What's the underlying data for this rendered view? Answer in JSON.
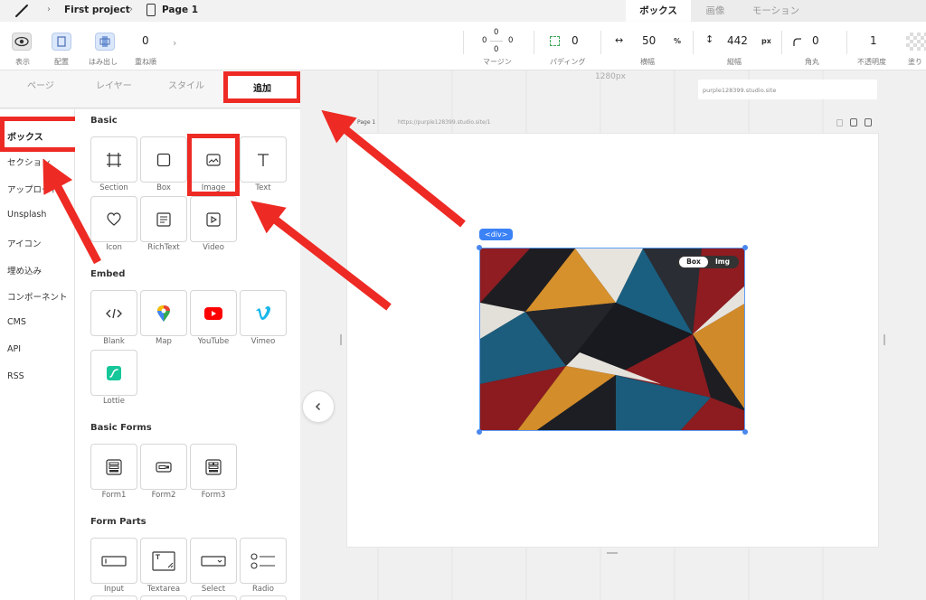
{
  "breadcrumb": {
    "project": "First project",
    "page": "Page 1"
  },
  "right_tabs": [
    {
      "label": "ボックス",
      "active": true
    },
    {
      "label": "画像",
      "active": false
    },
    {
      "label": "モーション",
      "active": false
    }
  ],
  "toolbar": {
    "show_label": "表示",
    "align_label": "配置",
    "overflow_label": "はみ出し",
    "zindex_value": "0",
    "zindex_label": "重ね順",
    "margin": {
      "top": "0",
      "left": "0",
      "right": "0",
      "bottom": "0",
      "label": "マージン"
    },
    "padding": {
      "value": "0",
      "label": "パディング"
    },
    "width": {
      "value": "50",
      "unit": "%",
      "label": "横幅"
    },
    "height": {
      "value": "442",
      "unit": "px",
      "label": "縦幅"
    },
    "radius": {
      "value": "0",
      "label": "角丸"
    },
    "opacity": {
      "value": "1",
      "label": "不透明度"
    },
    "fill_label": "塗り"
  },
  "left_tabs": [
    {
      "label": "ページ"
    },
    {
      "label": "レイヤー"
    },
    {
      "label": "スタイル"
    },
    {
      "label": "追加",
      "active": true
    }
  ],
  "categories": [
    {
      "label": "ボックス",
      "active": true
    },
    {
      "label": "セクション"
    },
    {
      "label": "アップロード"
    },
    {
      "label": "Unsplash"
    },
    {
      "label": "アイコン"
    },
    {
      "label": "埋め込み"
    },
    {
      "label": "コンポーネント"
    },
    {
      "label": "CMS"
    },
    {
      "label": "API"
    },
    {
      "label": "RSS"
    }
  ],
  "sections": {
    "basic": "Basic",
    "embed": "Embed",
    "basic_forms": "Basic Forms",
    "form_parts": "Form Parts"
  },
  "elements": {
    "basic": [
      {
        "label": "Section",
        "icon": "crop-icon"
      },
      {
        "label": "Box",
        "icon": "square-icon"
      },
      {
        "label": "Image",
        "icon": "image-icon"
      },
      {
        "label": "Text",
        "icon": "text-icon"
      },
      {
        "label": "Icon",
        "icon": "heart-icon"
      },
      {
        "label": "RichText",
        "icon": "richtext-icon"
      },
      {
        "label": "Video",
        "icon": "video-icon"
      }
    ],
    "embed": [
      {
        "label": "Blank",
        "icon": "code-icon"
      },
      {
        "label": "Map",
        "icon": "map-pin-icon"
      },
      {
        "label": "YouTube",
        "icon": "youtube-icon"
      },
      {
        "label": "Vimeo",
        "icon": "vimeo-icon"
      },
      {
        "label": "Lottie",
        "icon": "lottie-icon"
      }
    ],
    "basic_forms": [
      {
        "label": "Form1",
        "icon": "form1-icon"
      },
      {
        "label": "Form2",
        "icon": "form2-icon"
      },
      {
        "label": "Form3",
        "icon": "form3-icon"
      }
    ],
    "form_parts": [
      {
        "label": "Input",
        "icon": "input-icon"
      },
      {
        "label": "Textarea",
        "icon": "textarea-icon"
      },
      {
        "label": "Select",
        "icon": "select-icon"
      },
      {
        "label": "Radio",
        "icon": "radio-icon"
      }
    ]
  },
  "canvas": {
    "ruler_label": "1280px",
    "site_url": "purple128399.studio.site",
    "page_name": "Page 1",
    "page_url": "https://purple128399.studio.site/1",
    "div_tag": "<div>",
    "toggle": {
      "box": "Box",
      "img": "Img"
    }
  },
  "colors": {
    "accent_red": "#ee2a24",
    "selection_blue": "#3b82f6",
    "youtube_red": "#ff0000",
    "vimeo_blue": "#1ab7ea",
    "lottie_teal": "#16c79a"
  }
}
